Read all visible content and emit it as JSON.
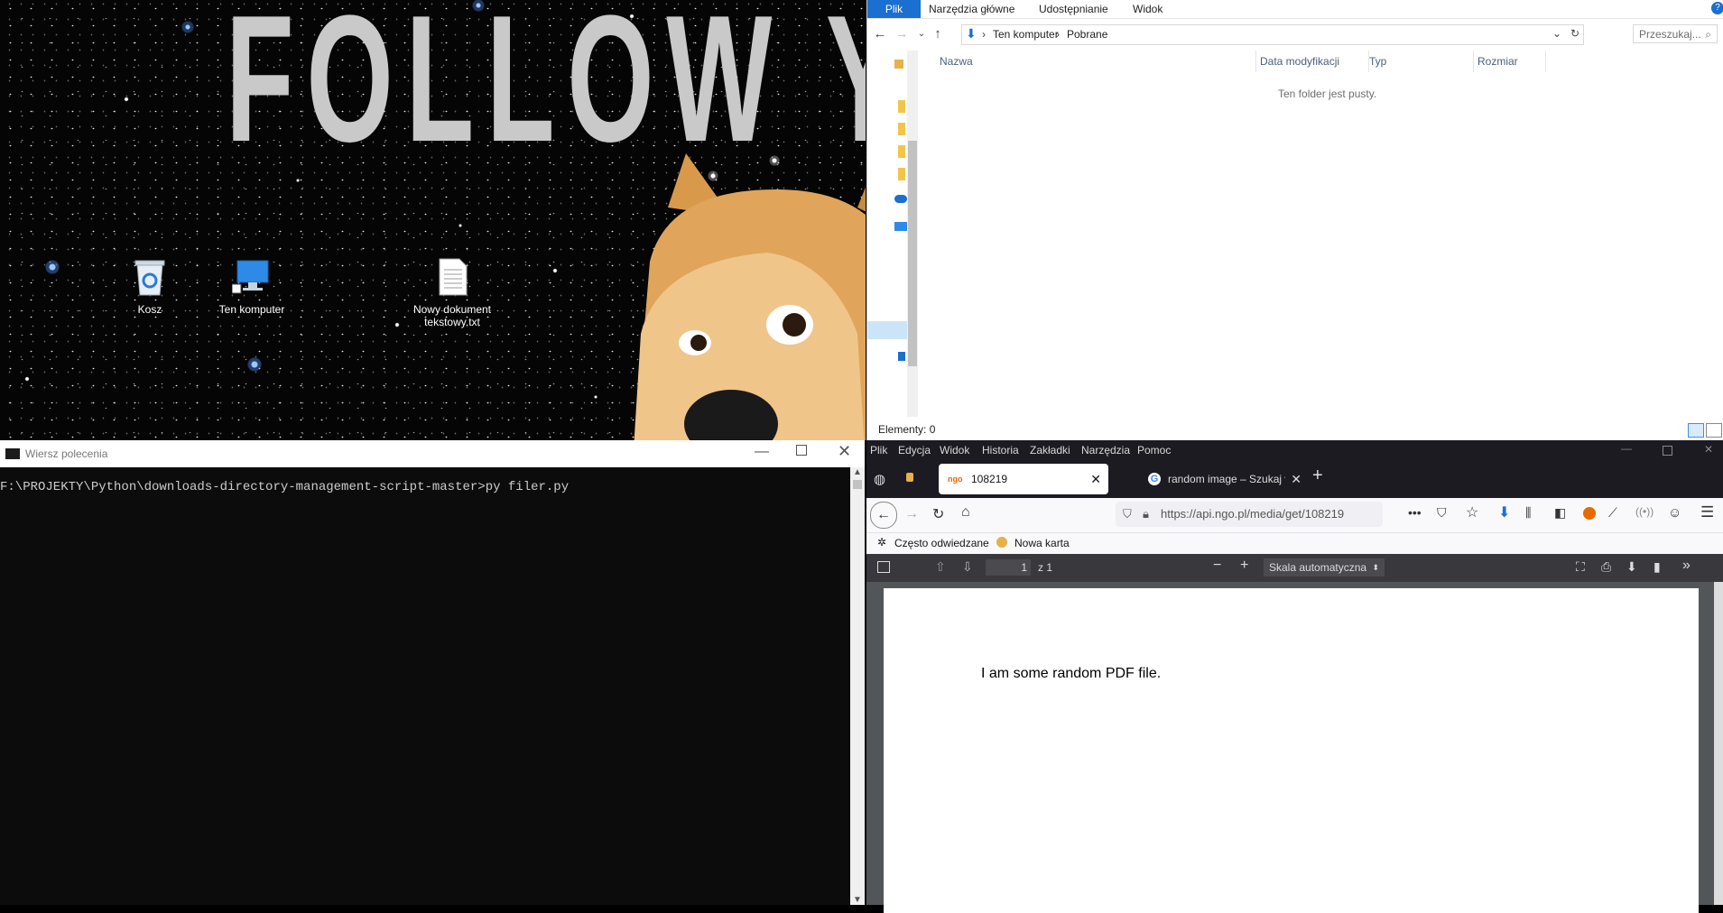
{
  "desktop": {
    "wallpaper_text": "FOLLOW YO",
    "icons": [
      {
        "label": "Kosz"
      },
      {
        "label": "Ten komputer"
      },
      {
        "label": "Nowy dokument tekstowy.txt"
      }
    ]
  },
  "explorer": {
    "ribbon_tabs": [
      "Plik",
      "Narzędzia główne",
      "Udostępnianie",
      "Widok"
    ],
    "breadcrumb": [
      "Ten komputer",
      "Pobrane"
    ],
    "search_placeholder": "Przeszukaj...",
    "columns": [
      "Nazwa",
      "Data modyfikacji",
      "Typ",
      "Rozmiar"
    ],
    "empty_message": "Ten folder jest pusty.",
    "status": "Elementy: 0"
  },
  "cmd": {
    "title": "Wiersz polecenia",
    "line": "F:\\PROJEKTY\\Python\\downloads-directory-management-script-master>py filer.py"
  },
  "firefox": {
    "menu": [
      "Plik",
      "Edycja",
      "Widok",
      "Historia",
      "Zakładki",
      "Narzędzia",
      "Pomoc"
    ],
    "tabs": [
      {
        "favicon_text": "ngo",
        "title": "108219",
        "active": true
      },
      {
        "title": "random image – Szukaj w Goo",
        "active": false
      }
    ],
    "url": "https://api.ngo.pl/media/get/108219",
    "bookmarks": [
      "Często odwiedzane",
      "Nowa karta"
    ],
    "pdf": {
      "page_number": "1",
      "page_total": "z 1",
      "zoom": "Skala automatyczna",
      "content": "I am some random PDF file."
    }
  }
}
